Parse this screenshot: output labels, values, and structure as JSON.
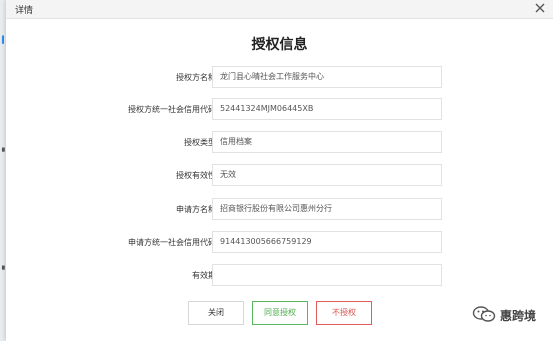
{
  "window": {
    "title": "详情"
  },
  "form": {
    "title": "授权信息",
    "fields": [
      {
        "label": "授权方名称",
        "value": "龙门县心晴社会工作服务中心"
      },
      {
        "label": "授权方统一社会信用代码",
        "value": "52441324MJM06445XB"
      },
      {
        "label": "授权类型",
        "value": "信用档案"
      },
      {
        "label": "授权有效性",
        "value": "无效"
      },
      {
        "label": "申请方名称",
        "value": "招商银行股份有限公司惠州分行"
      },
      {
        "label": "申请方统一社会信用代码",
        "value": "914413005666759129"
      },
      {
        "label": "有效期",
        "value": ""
      }
    ]
  },
  "buttons": {
    "close": "关闭",
    "agree": "同意授权",
    "deny": "不授权"
  },
  "watermark": {
    "text": "惠跨境",
    "icon": "wechat-icon"
  },
  "colors": {
    "agree": "#5cb85c",
    "deny": "#d9534f",
    "background_overlay": "#8f9296"
  }
}
